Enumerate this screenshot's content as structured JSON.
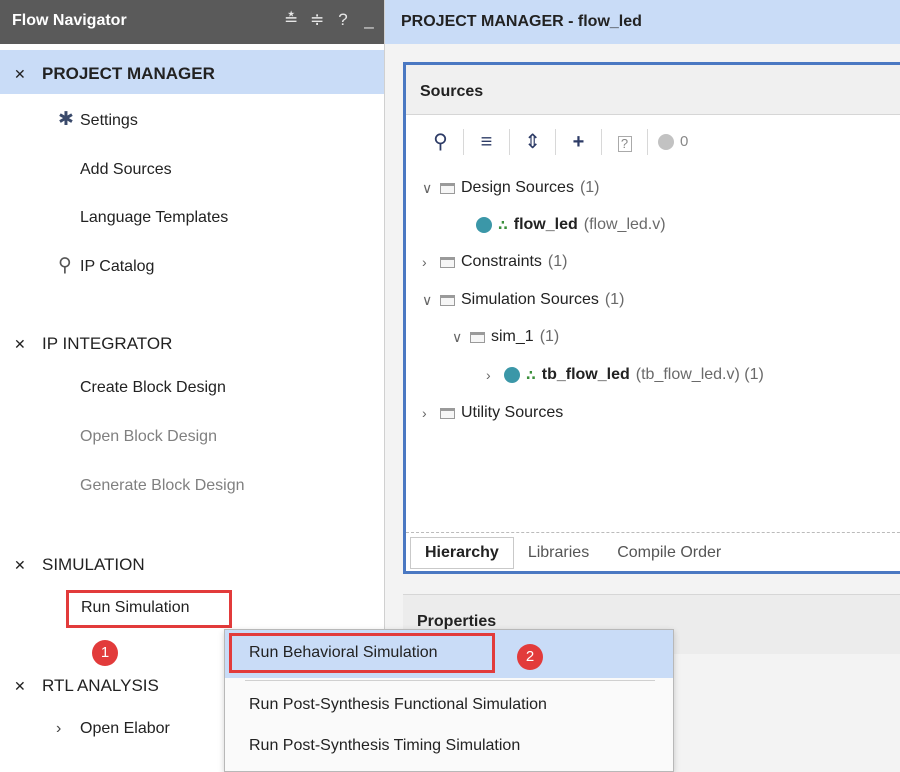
{
  "nav": {
    "title": "Flow Navigator",
    "tools": [
      "≛",
      "≑",
      "?",
      "_"
    ],
    "project_manager": {
      "label": "PROJECT MANAGER",
      "items": [
        "Settings",
        "Add Sources",
        "Language Templates",
        "IP Catalog"
      ]
    },
    "ip_integrator": {
      "label": "IP INTEGRATOR",
      "items": [
        "Create Block Design",
        "Open Block Design",
        "Generate Block Design"
      ]
    },
    "simulation": {
      "label": "SIMULATION",
      "items": [
        "Run Simulation"
      ]
    },
    "rtl_analysis": {
      "label": "RTL ANALYSIS",
      "items": [
        "Open Elabor"
      ]
    }
  },
  "main": {
    "title": "PROJECT MANAGER - flow_led",
    "sources": {
      "title": "Sources",
      "toolbar_count": "0",
      "tree": [
        {
          "label": "Design Sources",
          "suffix": "(1)"
        },
        {
          "label": "flow_led",
          "suffix": "(flow_led.v)"
        },
        {
          "label": "Constraints",
          "suffix": "(1)"
        },
        {
          "label": "Simulation Sources",
          "suffix": "(1)"
        },
        {
          "label": "sim_1",
          "suffix": "(1)"
        },
        {
          "label": "tb_flow_led",
          "suffix": "(tb_flow_led.v) (1)"
        },
        {
          "label": "Utility Sources",
          "suffix": ""
        }
      ],
      "tabs": [
        "Hierarchy",
        "Libraries",
        "Compile Order"
      ]
    },
    "properties": {
      "title": "Properties"
    }
  },
  "context_menu": {
    "items": [
      "Run Behavioral Simulation",
      "Run Post-Synthesis Functional Simulation",
      "Run Post-Synthesis Timing Simulation"
    ]
  },
  "annotations": {
    "step1": "1",
    "step2": "2",
    "highlight_color": "#e23b3b"
  }
}
